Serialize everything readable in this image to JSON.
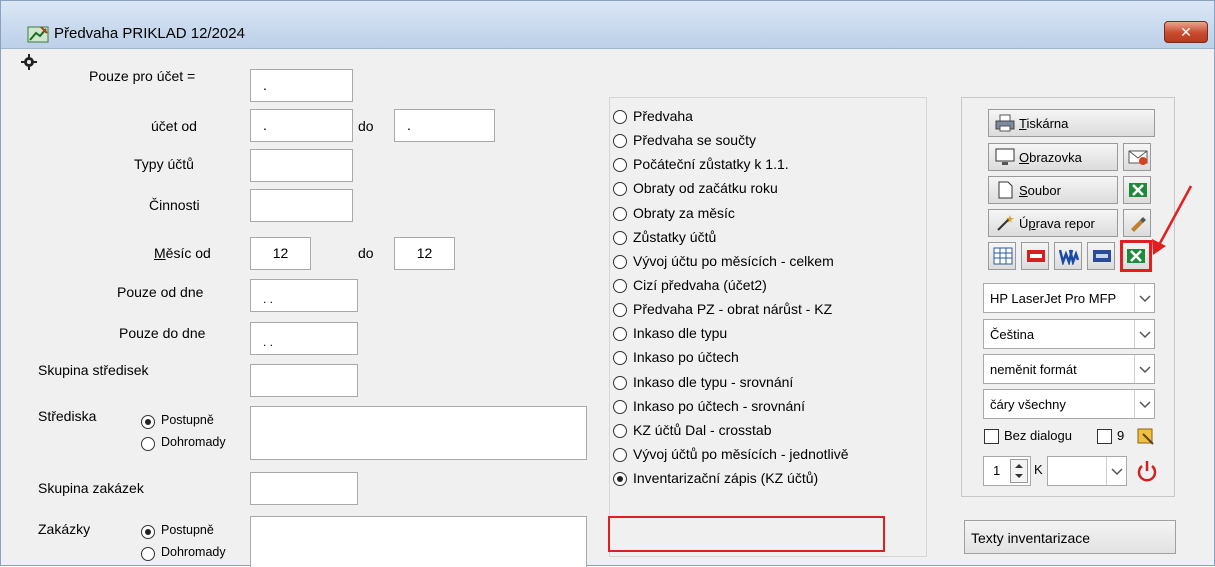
{
  "window": {
    "title": "Předvaha PRIKLAD  12/2024",
    "close_label": "✕"
  },
  "form": {
    "pouze_ucet_label": "Pouze pro  účet =",
    "pouze_ucet_value": ".",
    "ucet_od_label": "účet od",
    "ucet_od_value": ".",
    "ucet_do_label": "do",
    "ucet_do_value": ".",
    "typy_uctu_label": "Typy účtů",
    "typy_uctu_value": "",
    "cinnosti_label": "Činnosti",
    "cinnosti_value": "",
    "mesic_od_label_u": "M",
    "mesic_od_label_rest": "ěsíc od",
    "mesic_od_value": "12",
    "mesic_do_label": "do",
    "mesic_do_value": "12",
    "pouze_od_dne_label": "Pouze od dne",
    "pouze_od_dne_value": ". .",
    "pouze_do_dne_label": "Pouze do dne",
    "pouze_do_dne_value": ". .",
    "skupina_stredisek_label": "Skupina středisek",
    "skupina_stredisek_value": "",
    "strediska_label": "Střediska",
    "strediska_opt1": "Postupně",
    "strediska_opt2": "Dohromady",
    "skupina_zakazek_label": "Skupina zakázek",
    "skupina_zakazek_value": "",
    "zakazky_label": "Zakázky",
    "zakazky_opt1": "Postupně",
    "zakazky_opt2": "Dohromady"
  },
  "report_options": [
    "Předvaha",
    "Předvaha se součty",
    "Počáteční zůstatky k 1.1.",
    "Obraty od začátku roku",
    "Obraty za měsíc",
    "Zůstatky účtů",
    "Vývoj účtu po měsících - celkem",
    "Cizí předvaha (účet2)",
    "Předvaha PZ - obrat nárůst - KZ",
    "Inkaso dle typu",
    "Inkaso po účtech",
    "Inkaso dle typu - srovnání",
    "Inkaso po účtech - srovnání",
    "KZ účtů Dal - crosstab",
    "Vývoj účtů po měsících - jednotlivě",
    "Inventarizační zápis (KZ účtů)"
  ],
  "selected_report": "Inventarizační zápis (KZ účtů)",
  "output": {
    "tiskarna_u": "T",
    "tiskarna_rest": "iskárna",
    "obrazovka_u": "O",
    "obrazovka_rest": "brazovka",
    "soubor_u": "S",
    "soubor_rest": "oubor",
    "uprava_pre": "Ú",
    "uprava_u": "p",
    "uprava_rest": "rava repor",
    "printer": "HP LaserJet Pro MFP",
    "language": "Čeština",
    "format": "neměnit formát",
    "lines": "čáry všechny",
    "bez_dialogu": "Bez dialogu",
    "nine": "9",
    "copies": "1",
    "k_label": "K",
    "k_value": ""
  },
  "texty_button": "Texty inventarizace",
  "colors": {
    "highlight": "#e02020",
    "excel_green": "#1f8a3a",
    "power_red": "#d42020"
  }
}
